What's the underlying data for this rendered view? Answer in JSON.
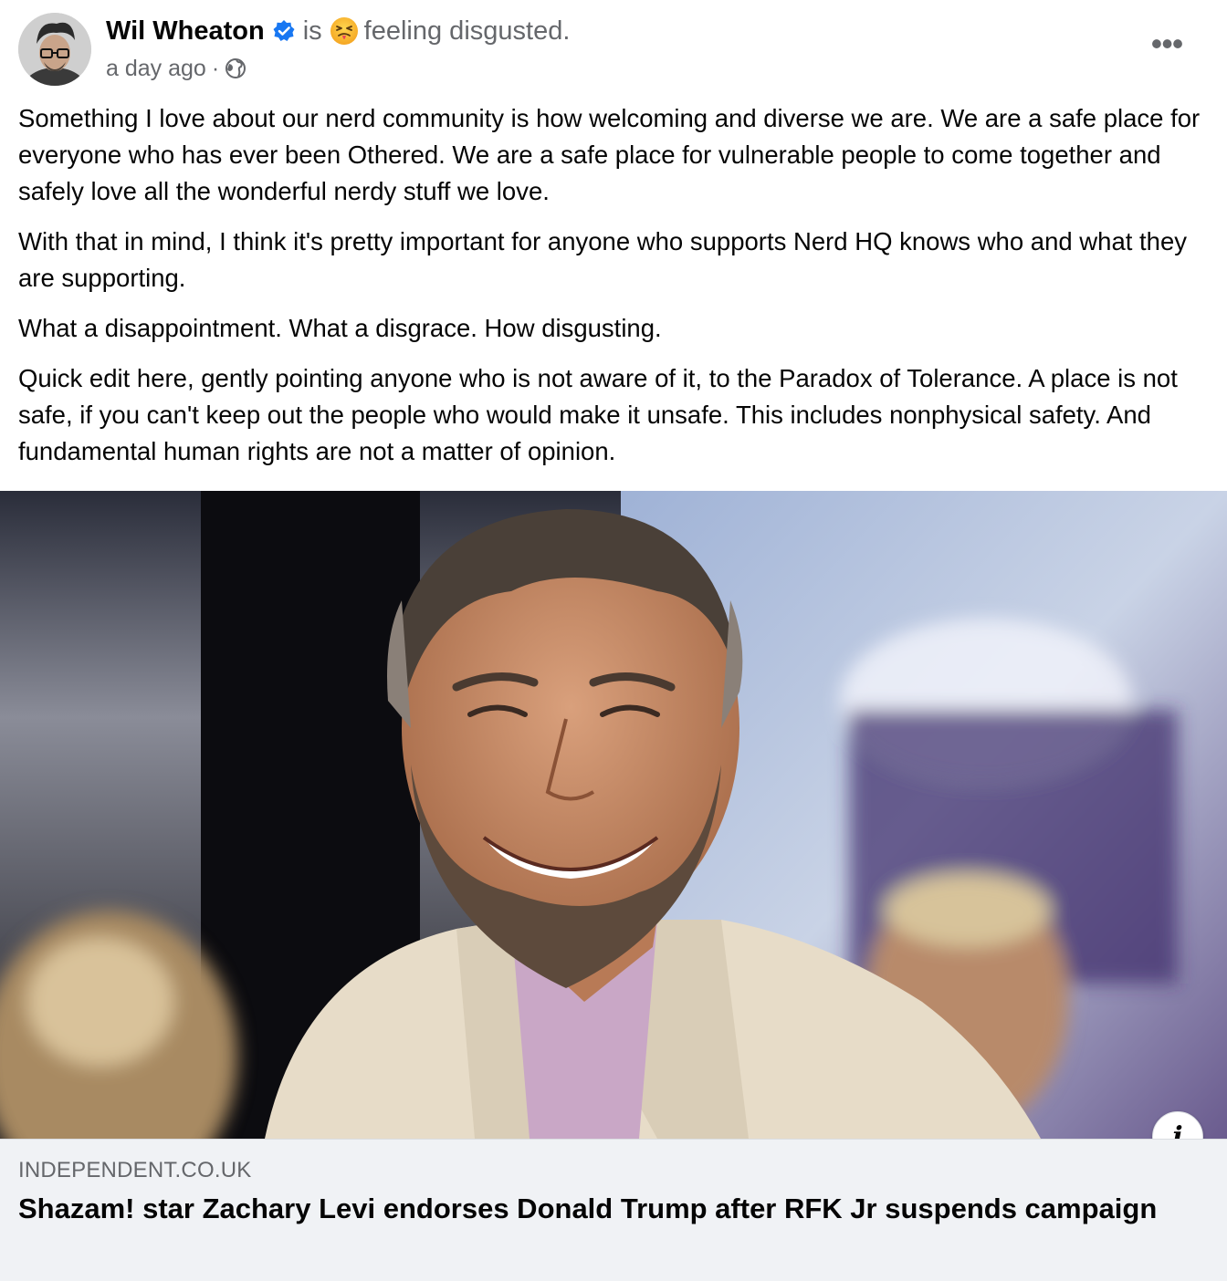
{
  "post": {
    "author": "Wil Wheaton",
    "is_word": "is",
    "feeling": "feeling disgusted.",
    "timestamp": "a day ago",
    "meta_separator": "·",
    "more_label": "•••",
    "paragraphs": [
      "Something I love about our nerd community is how welcoming and diverse we are. We are a safe place for everyone who has ever been Othered. We are a safe place for vulnerable people to come together and safely love all the wonderful nerdy stuff we love.",
      "With that in mind, I think it's pretty important for anyone who supports Nerd HQ knows who and what they are supporting.",
      "What a disappointment. What a disgrace. How disgusting.",
      "Quick edit here, gently pointing anyone who is not aware of it, to the Paradox of Tolerance. A place is not safe, if you can't keep out the people who would make it unsafe. This includes nonphysical safety. And fundamental human rights are not a matter of opinion."
    ]
  },
  "link_preview": {
    "domain": "INDEPENDENT.CO.UK",
    "title": "Shazam! star Zachary Levi endorses Donald Trump after RFK Jr suspends campaign",
    "info_label": "i"
  },
  "icons": {
    "verified": "verified-badge-icon",
    "feeling": "disgusted-face-emoji-icon",
    "privacy": "globe-icon",
    "more": "more-options-icon",
    "info": "info-icon"
  },
  "colors": {
    "text_primary": "#050505",
    "text_secondary": "#65676b",
    "verified_blue": "#1877f2",
    "caption_bg": "#f0f2f5"
  }
}
